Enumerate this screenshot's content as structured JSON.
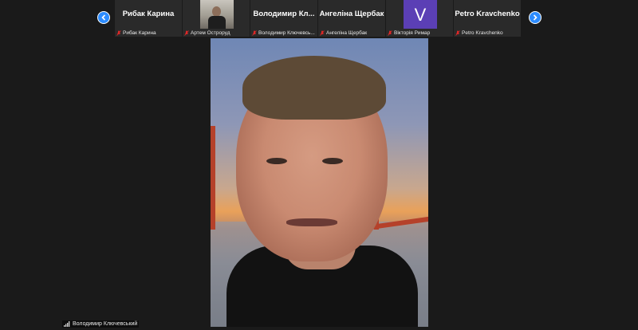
{
  "participants": [
    {
      "display": "Рибак Карина",
      "label": "Рибак Карина",
      "type": "name"
    },
    {
      "display": "",
      "label": "Артем Остроруд",
      "type": "video"
    },
    {
      "display": "Володимир  Кл...",
      "label": "Володимир Ключевсь...",
      "type": "name"
    },
    {
      "display": "Ангеліна Щербак",
      "label": "Ангеліна Щербак",
      "type": "name"
    },
    {
      "display": "V",
      "label": "Вікторія Римар",
      "type": "avatar"
    },
    {
      "display": "Petro Kravchenko",
      "label": "Petro Kravchenko",
      "type": "name"
    }
  ],
  "speaker": {
    "label": "Володимир Ключевський"
  },
  "colors": {
    "nav_accent": "#2d8cff",
    "muted_icon": "#e02828",
    "avatar_bg": "#5b3fb5"
  },
  "icons": {
    "prev": "chevron-left-icon",
    "next": "chevron-right-icon",
    "muted": "mic-muted-icon",
    "signal": "signal-bars-icon"
  }
}
